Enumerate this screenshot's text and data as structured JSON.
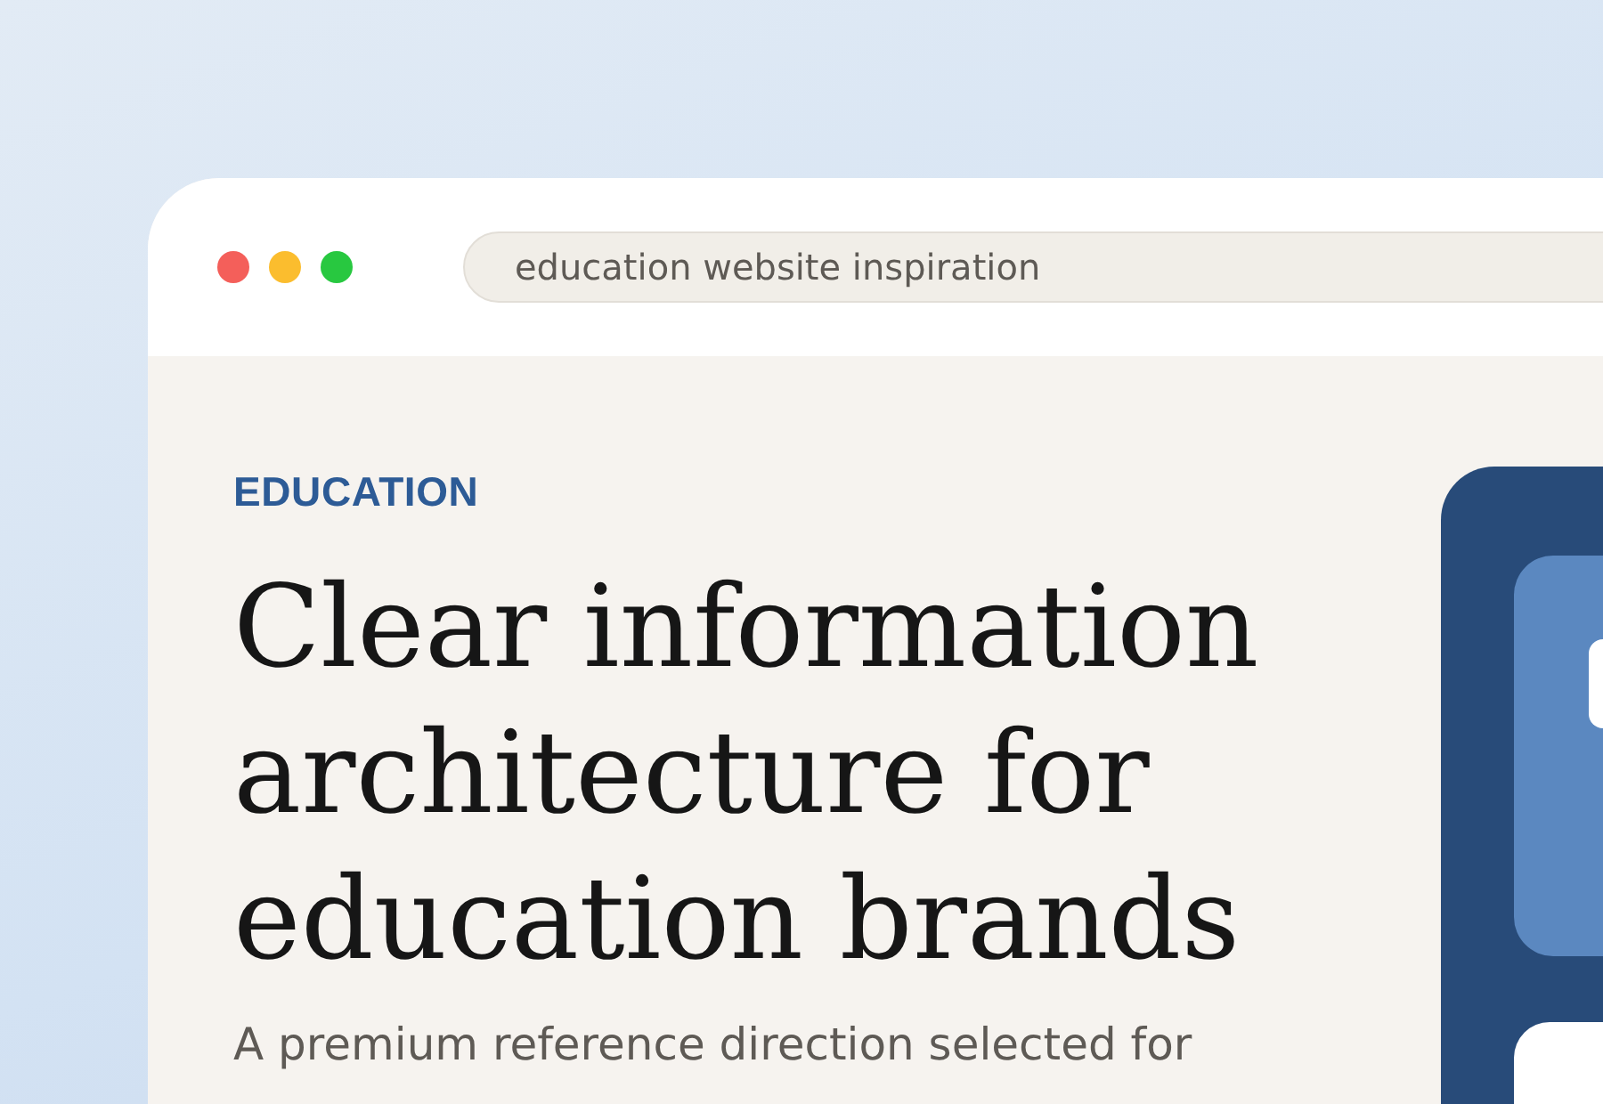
{
  "browser": {
    "address": "education website inspiration"
  },
  "hero": {
    "eyebrow": "EDUCATION",
    "heading": "Clear information architecture for education brands",
    "lead": "A premium reference direction selected for"
  }
}
